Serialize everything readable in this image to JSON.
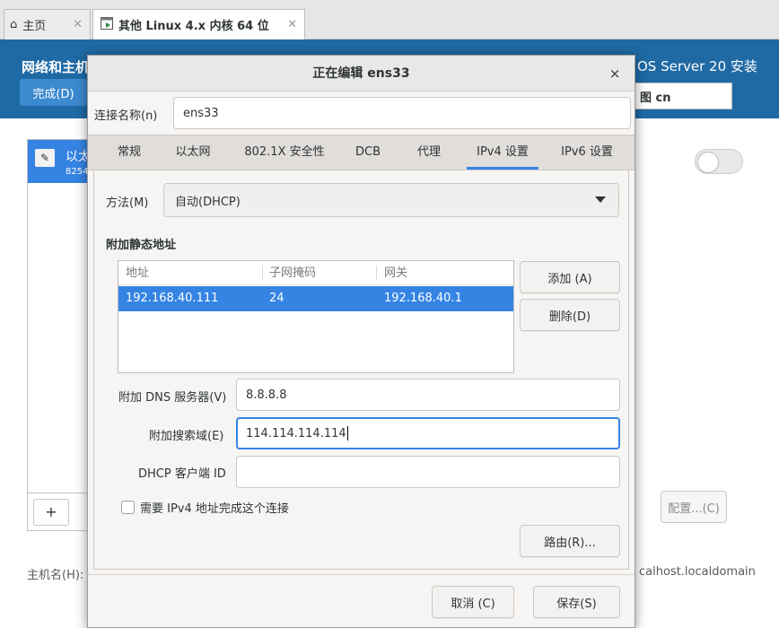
{
  "vm_tabs": {
    "home_label": "主页",
    "home_close": "✕",
    "active_label": "其他 Linux 4.x 内核 64 位",
    "active_close": "✕"
  },
  "background": {
    "title": "网络和主机",
    "done_button": "完成(D)",
    "product": "OS Server 20 安装",
    "keyboard": "图 cn",
    "device_name": "以太",
    "device_sub": "8254",
    "add_button": "+",
    "config_button": "配置...(C)",
    "hostname_label": "主机名(H):",
    "hostname_value": "calhost.localdomain"
  },
  "dialog": {
    "title": "正在编辑 ens33",
    "close_icon": "×",
    "connection_name_label": "连接名称(n)",
    "connection_name_value": "ens33",
    "tabs": [
      {
        "label": "常规"
      },
      {
        "label": "以太网"
      },
      {
        "label": "802.1X 安全性"
      },
      {
        "label": "DCB"
      },
      {
        "label": "代理"
      },
      {
        "label": "IPv4 设置"
      },
      {
        "label": "IPv6 设置"
      }
    ],
    "active_tab": "IPv4 设置",
    "method_label": "方法(M)",
    "method_value": "自动(DHCP)",
    "static_section": "附加静态地址",
    "table": {
      "headers": [
        "地址",
        "子网掩码",
        "网关"
      ],
      "rows": [
        {
          "address": "192.168.40.111",
          "netmask": "24",
          "gateway": "192.168.40.1"
        }
      ]
    },
    "add_button": "添加 (A)",
    "delete_button": "删除(D)",
    "dns_label": "附加 DNS 服务器(V)",
    "dns_value": "8.8.8.8",
    "search_label": "附加搜索域(E)",
    "search_value": "114.114.114.114",
    "dhcp_label": "DHCP 客户端 ID",
    "dhcp_value": "",
    "require_ipv4_label": "需要 IPv4 地址完成这个连接",
    "require_ipv4_checked": false,
    "routes_button": "路由(R)...",
    "cancel_button": "取消 (C)",
    "save_button": "保存(S)"
  },
  "colors": {
    "accent": "#3584e4",
    "installer_blue": "#1f6aa5"
  }
}
